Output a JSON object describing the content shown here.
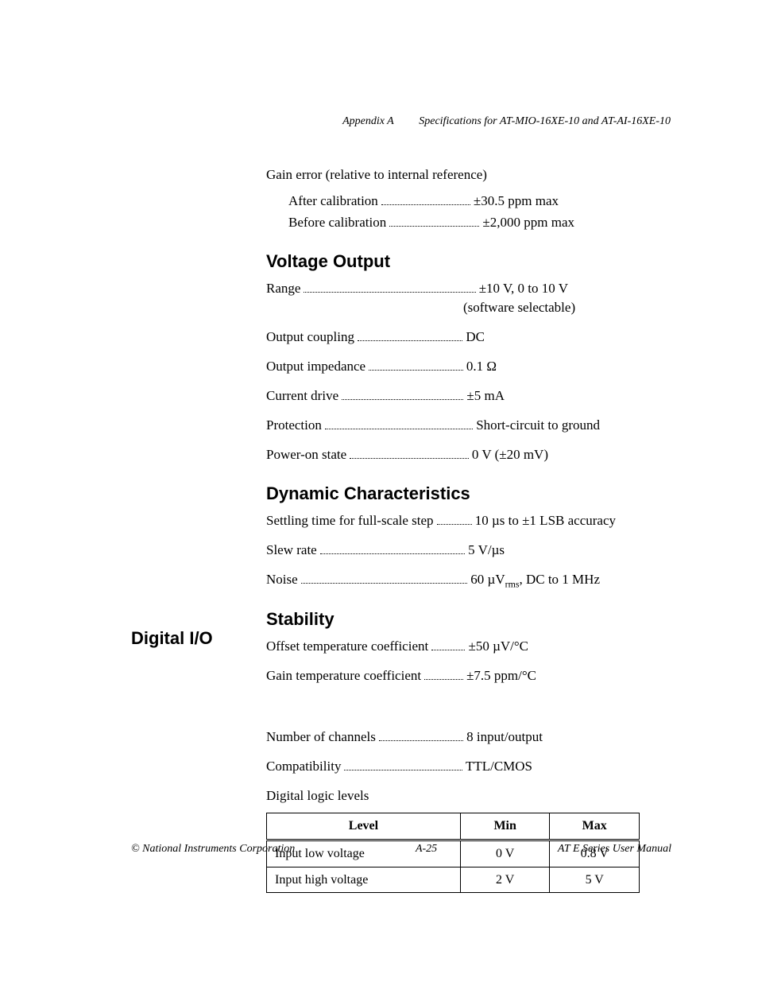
{
  "header": {
    "appendix": "Appendix A",
    "title": "Specifications for AT-MIO-16XE-10 and AT-AI-16XE-10"
  },
  "gain_error": {
    "title": "Gain error (relative to internal reference)",
    "after_cal_label": "After calibration",
    "after_cal_value": "±30.5 ppm max",
    "before_cal_label": "Before calibration",
    "before_cal_value": "±2,000 ppm max"
  },
  "voltage_output": {
    "heading": "Voltage Output",
    "range_label": "Range",
    "range_value": "±10 V, 0 to 10 V",
    "range_note": "(software selectable)",
    "coupling_label": "Output coupling",
    "coupling_value": "DC",
    "impedance_label": "Output impedance",
    "impedance_value": "0.1 Ω",
    "current_label": "Current drive",
    "current_value": "±5 mA",
    "protection_label": "Protection",
    "protection_value": "Short-circuit to ground",
    "poweron_label": "Power-on state",
    "poweron_value": "0 V (±20 mV)"
  },
  "dynamic": {
    "heading": "Dynamic Characteristics",
    "settling_label": "Settling time for full-scale step",
    "settling_value": "10 µs to ±1 LSB accuracy",
    "slew_label": "Slew rate",
    "slew_value": "5 V/µs",
    "noise_label": "Noise",
    "noise_value_pre": "60 µV",
    "noise_value_sub": "rms",
    "noise_value_post": ", DC to 1 MHz"
  },
  "stability": {
    "heading": "Stability",
    "offset_label": "Offset temperature coefficient",
    "offset_value": "±50 µV/°C",
    "gain_label": "Gain temperature coefficient",
    "gain_value": "±7.5 ppm/°C"
  },
  "digital_io": {
    "heading": "Digital I/O",
    "channels_label": "Number of channels",
    "channels_value": "8 input/output",
    "compat_label": "Compatibility",
    "compat_value": "TTL/CMOS",
    "logic_intro": "Digital logic levels",
    "table": {
      "col_level": "Level",
      "col_min": "Min",
      "col_max": "Max",
      "rows": [
        {
          "level": "Input low voltage",
          "min": "0 V",
          "max": "0.8 V"
        },
        {
          "level": "Input high voltage",
          "min": "2 V",
          "max": "5 V"
        }
      ]
    }
  },
  "footer": {
    "left": "© National Instruments Corporation",
    "center": "A-25",
    "right": "AT E Series User Manual"
  }
}
